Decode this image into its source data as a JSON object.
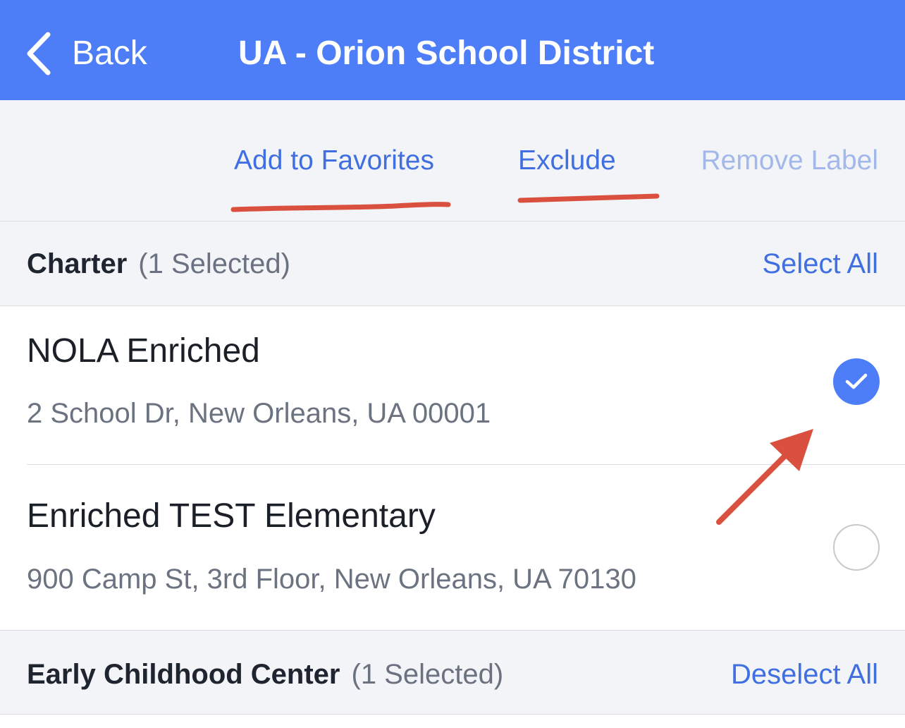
{
  "navbar": {
    "back_label": "Back",
    "title": "UA - Orion School District",
    "color": "#4d7ef7"
  },
  "actions": {
    "add_to_favorites": "Add to Favorites",
    "exclude": "Exclude",
    "remove_label": "Remove Label"
  },
  "sections": [
    {
      "title": "Charter",
      "count": "(1 Selected)",
      "action": "Select All",
      "schools": [
        {
          "name": "NOLA Enriched",
          "address": "2 School Dr, New Orleans, UA 00001",
          "selected": true
        },
        {
          "name": "Enriched TEST Elementary",
          "address": "900 Camp St, 3rd Floor, New Orleans, UA 70130",
          "selected": false
        }
      ]
    },
    {
      "title": "Early Childhood Center",
      "count": "(1 Selected)",
      "action": "Deselect All"
    }
  ],
  "annotation_color": "#d9503f"
}
